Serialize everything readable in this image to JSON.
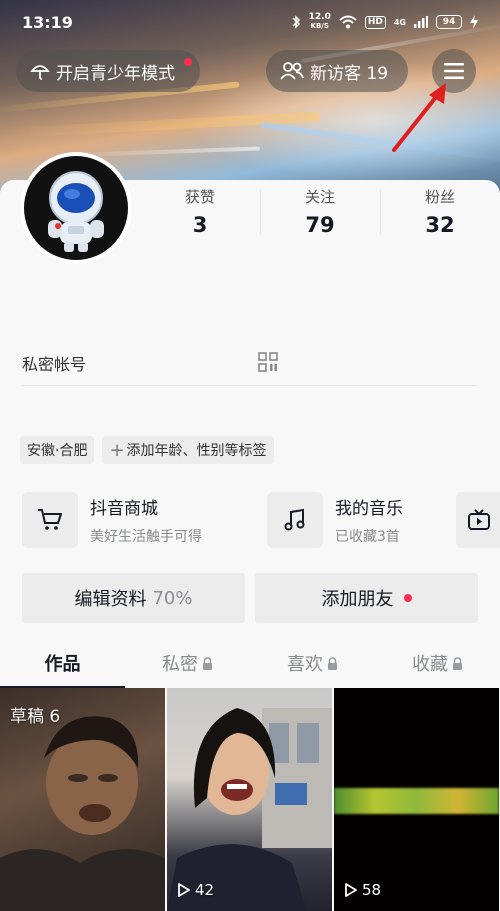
{
  "status_bar": {
    "time": "13:19",
    "network_speed_value": "12.0",
    "network_speed_unit": "KB/S",
    "hd_badge": "HD",
    "cell_label": "4G",
    "battery": "94"
  },
  "header": {
    "teen_mode_label": "开启青少年模式",
    "visitors_label": "新访客 19"
  },
  "stats": [
    {
      "label": "获赞",
      "value": "3"
    },
    {
      "label": "关注",
      "value": "79"
    },
    {
      "label": "粉丝",
      "value": "32"
    }
  ],
  "private_account_label": "私密帐号",
  "tags": {
    "location": "安徽·合肥",
    "add_tags": "添加年龄、性别等标签"
  },
  "features": [
    {
      "title": "抖音商城",
      "subtitle": "美好生活触手可得",
      "icon": "cart-icon"
    },
    {
      "title": "我的音乐",
      "subtitle": "已收藏3首",
      "icon": "music-note-icon"
    },
    {
      "title": "",
      "subtitle": "",
      "icon": "tv-icon"
    }
  ],
  "buttons": {
    "edit_profile": "编辑资料",
    "edit_profile_progress": "70%",
    "add_friends": "添加朋友"
  },
  "tabs": [
    {
      "label": "作品",
      "active": true,
      "locked": false
    },
    {
      "label": "私密",
      "active": false,
      "locked": true
    },
    {
      "label": "喜欢",
      "active": false,
      "locked": true
    },
    {
      "label": "收藏",
      "active": false,
      "locked": true
    }
  ],
  "videos": [
    {
      "overlay": "草稿 6"
    },
    {
      "plays": "42"
    },
    {
      "plays": "58"
    }
  ],
  "colors": {
    "accent_red": "#fe2c55",
    "annotation_arrow": "#e02020"
  }
}
